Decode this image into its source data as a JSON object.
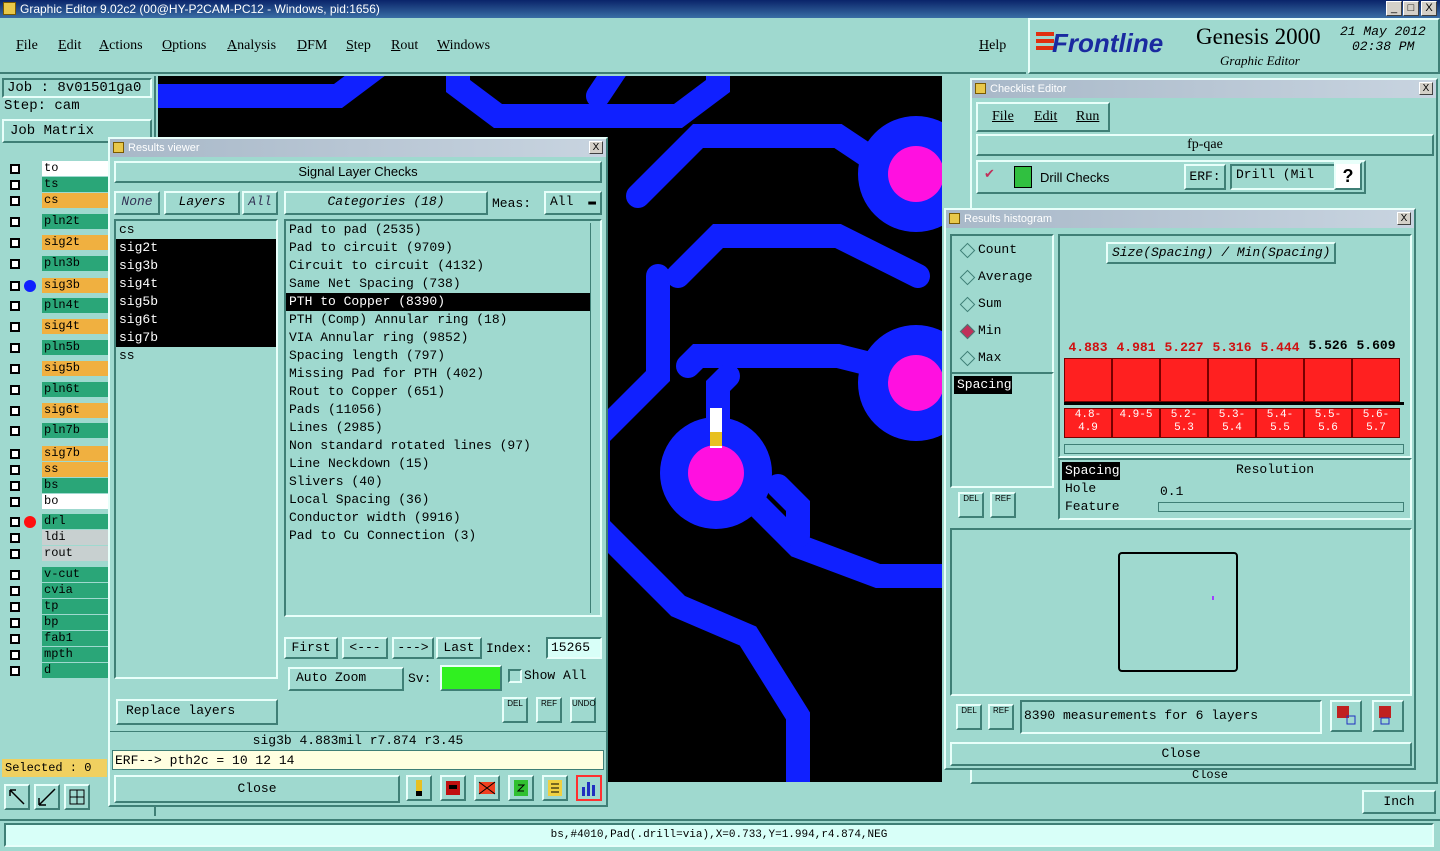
{
  "window": {
    "title": "Graphic Editor 9.02c2 (00@HY-P2CAM-PC12 - Windows, pid:1656)",
    "min": "_",
    "max": "□",
    "close": "X"
  },
  "menu": {
    "items": [
      "File",
      "Edit",
      "Actions",
      "Options",
      "Analysis",
      "DFM",
      "Step",
      "Rout",
      "Windows"
    ],
    "help": "Help"
  },
  "brand": {
    "logo": "Frontline",
    "product": "Genesis 2000",
    "subtitle": "Graphic Editor",
    "date": "21 May 2012",
    "time": "02:38 PM"
  },
  "side": {
    "job": "Job : 8v01501ga0",
    "step": "Step: cam",
    "job_matrix": "Job Matrix",
    "selected": "Selected : 0",
    "layers": [
      {
        "name": "to",
        "color": "#ffffff"
      },
      {
        "name": "ts",
        "color": "#2aa678"
      },
      {
        "name": "cs",
        "color": "#f0b040"
      },
      {
        "name": "pln2t",
        "color": "#2aa678"
      },
      {
        "name": "sig2t",
        "color": "#f0b040"
      },
      {
        "name": "pln3b",
        "color": "#2aa678"
      },
      {
        "name": "sig3b",
        "color": "#f0b040"
      },
      {
        "name": "pln4t",
        "color": "#2aa678"
      },
      {
        "name": "sig4t",
        "color": "#f0b040"
      },
      {
        "name": "pln5b",
        "color": "#2aa678"
      },
      {
        "name": "sig5b",
        "color": "#f0b040"
      },
      {
        "name": "pln6t",
        "color": "#2aa678"
      },
      {
        "name": "sig6t",
        "color": "#f0b040"
      },
      {
        "name": "pln7b",
        "color": "#2aa678"
      },
      {
        "name": "sig7b",
        "color": "#f0b040"
      },
      {
        "name": "ss",
        "color": "#f0b040"
      },
      {
        "name": "bs",
        "color": "#2aa678"
      },
      {
        "name": "bo",
        "color": "#ffffff"
      },
      {
        "name": "drl",
        "color": "#2aa678"
      },
      {
        "name": "ldi",
        "color": "#c8d0d0"
      },
      {
        "name": "rout",
        "color": "#c8d0d0"
      },
      {
        "name": "v-cut",
        "color": "#2aa678"
      },
      {
        "name": "cvia",
        "color": "#2aa678"
      },
      {
        "name": "tp",
        "color": "#2aa678"
      },
      {
        "name": "bp",
        "color": "#2aa678"
      },
      {
        "name": "fab1",
        "color": "#2aa678"
      },
      {
        "name": "mpth",
        "color": "#2aa678"
      },
      {
        "name": "d",
        "color": "#2aa678"
      }
    ]
  },
  "results": {
    "title": "Results viewer",
    "header": "Signal Layer Checks",
    "none": "None",
    "layers_btn": "Layers",
    "all": "All",
    "categories_btn": "Categories (18)",
    "meas_label": "Meas:",
    "meas_value": "All",
    "layer_list": [
      "cs",
      "sig2t",
      "sig3b",
      "sig4t",
      "sig5b",
      "sig6t",
      "sig7b",
      "ss"
    ],
    "categories": [
      "Pad to pad (2535)",
      "Pad to circuit (9709)",
      "Circuit to circuit (4132)",
      "Same Net Spacing (738)",
      "PTH to Copper (8390)",
      "PTH (Comp) Annular ring (18)",
      "VIA Annular ring (9852)",
      "Spacing length (797)",
      "Missing Pad for PTH (402)",
      "Rout to Copper (651)",
      "Pads (11056)",
      "Lines (2985)",
      "Non standard rotated lines (97)",
      "Line Neckdown (15)",
      "Slivers (40)",
      "Local Spacing (36)",
      "Conductor width (9916)",
      "Pad to Cu Connection (3)"
    ],
    "first": "First",
    "prev": "<---",
    "next": "--->",
    "last": "Last",
    "index_label": "Index:",
    "index_value": "15265",
    "auto_zoom": "Auto Zoom",
    "sv_label": "Sv:",
    "show_all": "Show All",
    "replace_layers": "Replace layers",
    "del": "DEL",
    "ref": "REF",
    "undo": "UNDO",
    "info": "sig3b 4.883mil  r7.874  r3.45",
    "erf": "ERF--> pth2c = 10 12 14",
    "close": "Close"
  },
  "checklist": {
    "title": "Checklist Editor",
    "menu": [
      "File",
      "Edit",
      "Run"
    ],
    "name": "fp-qae",
    "check": "Drill Checks",
    "erf_label": "ERF:",
    "erf_value": "Drill (Mil",
    "help": "?",
    "close": "Close"
  },
  "histogram": {
    "title": "Results histogram",
    "modes": [
      "Count",
      "Average",
      "Sum",
      "Min",
      "Max"
    ],
    "selected_mode": "Min",
    "left_list": [
      "Spacing"
    ],
    "chart_title": "Size(Spacing) / Min(Spacing)",
    "group_list": [
      "Spacing",
      "Hole",
      "Feature"
    ],
    "resolution_label": "Resolution",
    "resolution_value": "0.1",
    "summary": "8390 measurements for 6 layers",
    "close": "Close",
    "del": "DEL",
    "ref": "REF"
  },
  "chart_data": {
    "type": "bar",
    "title": "Size(Spacing) / Min(Spacing)",
    "categories": [
      "4.8-4.9",
      "4.9-5",
      "5.2-5.3",
      "5.3-5.4",
      "5.4-5.5",
      "5.5-5.6",
      "5.6-5.7"
    ],
    "values": [
      4.883,
      4.981,
      5.227,
      5.316,
      5.444,
      5.526,
      5.609
    ]
  },
  "bottom": {
    "unit": "Inch",
    "status": "bs,#4010,Pad(.drill=via),X=0.733,Y=1.994,r4.874,NEG"
  },
  "colors": {
    "bg": "#9fd9cf",
    "copper": "#1020ff",
    "pad": "#ff10e0",
    "bar": "#ff2020"
  }
}
